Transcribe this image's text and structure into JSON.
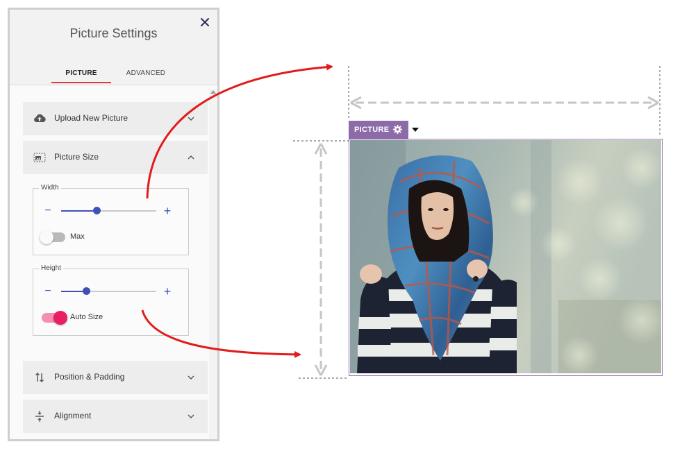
{
  "panel": {
    "title": "Picture Settings",
    "close_icon": "close-icon",
    "tabs": [
      {
        "label": "PICTURE",
        "active": true
      },
      {
        "label": "ADVANCED",
        "active": false
      }
    ],
    "sections": {
      "upload": {
        "label": "Upload New Picture",
        "icon": "cloud-upload-icon",
        "expanded": false
      },
      "size": {
        "label": "Picture Size",
        "icon": "image-size-icon",
        "expanded": true
      },
      "position": {
        "label": "Position & Padding",
        "icon": "position-arrows-icon",
        "expanded": false
      },
      "alignment": {
        "label": "Alignment",
        "icon": "alignment-icon",
        "expanded": false
      }
    },
    "width_group": {
      "legend": "Width",
      "minus": "−",
      "plus": "+",
      "slider_value_fraction": 0.37,
      "toggle_label": "Max",
      "toggle_on": false
    },
    "height_group": {
      "legend": "Height",
      "minus": "−",
      "plus": "+",
      "slider_value_fraction": 0.26,
      "toggle_label": "Auto Size",
      "toggle_on": true
    }
  },
  "preview": {
    "tag_label": "PICTURE",
    "tag_icon": "gear-icon",
    "dropdown_icon": "caret-down-icon",
    "image_subject": "photo-woman-in-headscarf"
  },
  "colors": {
    "accent_blue": "#3f51b5",
    "toggle_pink": "#e91e63",
    "tab_underline": "#e03a3a",
    "arrow_red": "#e21b1b",
    "tag_purple": "#8d6aa8"
  }
}
